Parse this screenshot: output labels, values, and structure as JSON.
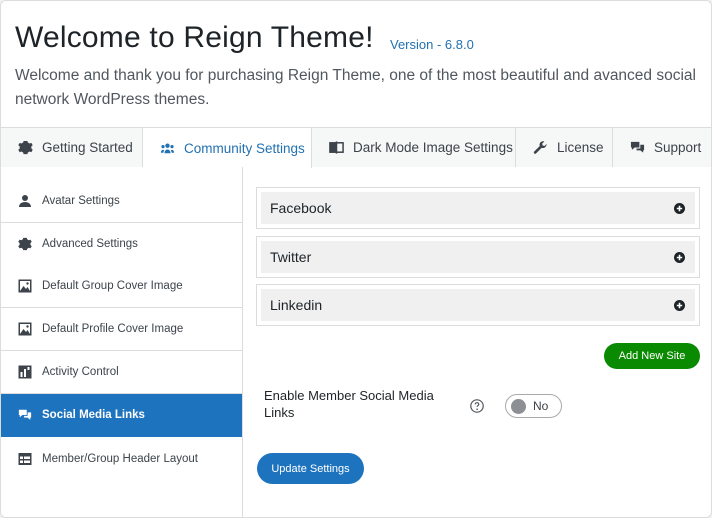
{
  "header": {
    "title": "Welcome to Reign Theme!",
    "version": "Version - 6.8.0",
    "intro": "Welcome and thank you for purchasing Reign Theme, one of the most beautiful and avanced social network WordPress themes."
  },
  "tabs": [
    {
      "label": "Getting Started",
      "icon": "gear-icon"
    },
    {
      "label": "Community Settings",
      "icon": "community-icon"
    },
    {
      "label": "Dark Mode Image Settings",
      "icon": "dark-mode-image-icon"
    },
    {
      "label": "License",
      "icon": "wrench-icon"
    },
    {
      "label": "Support",
      "icon": "chat-icon"
    }
  ],
  "active_tab": "Community Settings",
  "sidebar": {
    "items": [
      {
        "label": "Avatar Settings",
        "icon": "user-icon"
      },
      {
        "label": "Advanced Settings",
        "icon": "gear-icon"
      },
      {
        "label": "Default Group Cover Image",
        "icon": "image-icon"
      },
      {
        "label": "Default Profile Cover Image",
        "icon": "image-icon"
      },
      {
        "label": "Activity Control",
        "icon": "activity-icon"
      },
      {
        "label": "Social Media Links",
        "icon": "chat-icon"
      },
      {
        "label": "Member/Group Header Layout",
        "icon": "layout-icon"
      }
    ],
    "active": "Social Media Links"
  },
  "main": {
    "accordions": [
      {
        "label": "Facebook"
      },
      {
        "label": "Twitter"
      },
      {
        "label": "Linkedin"
      }
    ],
    "add_site_label": "Add New Site",
    "enable_label": "Enable Member Social Media Links",
    "toggle_value": "No",
    "update_label": "Update Settings"
  },
  "colors": {
    "accent": "#1e73be",
    "add_button": "#0a8a00",
    "link": "#2271b1"
  }
}
